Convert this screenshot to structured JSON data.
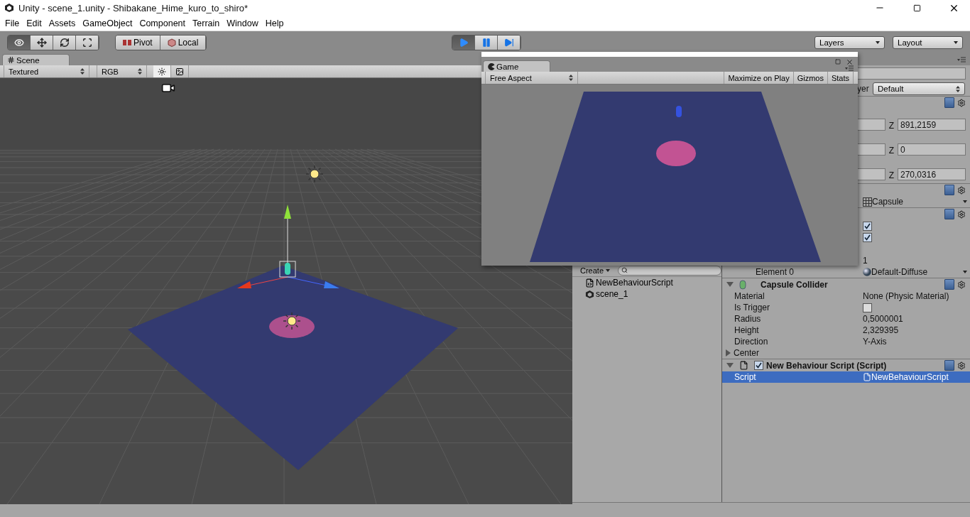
{
  "window": {
    "title": "Unity - scene_1.unity - Shibakane_Hime_kuro_to_shiro*"
  },
  "menu": [
    "File",
    "Edit",
    "Assets",
    "GameObject",
    "Component",
    "Terrain",
    "Window",
    "Help"
  ],
  "toolbar": {
    "tools": [
      {
        "kind": "view",
        "selected": true
      },
      {
        "kind": "move",
        "selected": false
      },
      {
        "kind": "rotate",
        "selected": false
      },
      {
        "kind": "scale",
        "selected": false
      }
    ],
    "handles": [
      {
        "kind": "pivot",
        "label": "Pivot"
      },
      {
        "kind": "local",
        "label": "Local"
      }
    ],
    "playback": [
      {
        "kind": "play",
        "selected": true
      },
      {
        "kind": "pause",
        "selected": false
      },
      {
        "kind": "step",
        "selected": false
      }
    ],
    "layers": "Layers",
    "layout": "Layout"
  },
  "scene": {
    "tab": {
      "label": "Scene",
      "selected": true
    },
    "render_mode": "Textured",
    "channel": "RGB",
    "toggles": [
      {
        "kind": "lighting",
        "on": true
      },
      {
        "kind": "skybox",
        "on": false
      }
    ]
  },
  "game": {
    "tab": {
      "label": "Game",
      "selected": true
    },
    "aspect": "Free Aspect",
    "buttons": [
      {
        "label": "Maximize on Play",
        "on": false
      },
      {
        "label": "Gizmos",
        "on": false
      },
      {
        "label": "Stats",
        "on": false
      }
    ]
  },
  "project": {
    "create": "Create",
    "items": [
      {
        "kind": "script",
        "label": "NewBehaviourScript"
      },
      {
        "kind": "scene",
        "label": "scene_1"
      }
    ]
  },
  "inspector": {
    "rows": [
      {
        "kind": "name"
      },
      {
        "kind": "layer",
        "label": "yer",
        "value": "Default"
      },
      {
        "kind": "header"
      },
      {
        "kind": "vector",
        "axis": "Z",
        "value": "891,2159"
      },
      {
        "kind": "vector",
        "axis": "Z",
        "value": "0"
      },
      {
        "kind": "vector",
        "axis": "Z",
        "value": "270,0316"
      },
      {
        "kind": "header"
      },
      {
        "kind": "mesh",
        "value": "Capsule"
      },
      {
        "kind": "header"
      },
      {
        "kind": "check",
        "checked": true
      },
      {
        "kind": "check",
        "checked": true
      },
      {
        "kind": "count",
        "value": "1"
      },
      {
        "kind": "material",
        "label": "Element 0",
        "value": "Default-Diffuse",
        "selected": false
      },
      {
        "kind": "collider_header",
        "title": "Capsule Collider",
        "expanded": true
      },
      {
        "kind": "property",
        "label": "Material",
        "value": "None (Physic Material)",
        "selected": false
      },
      {
        "kind": "toggle",
        "label": "Is Trigger",
        "checked": false,
        "selected": false
      },
      {
        "kind": "property",
        "label": "Radius",
        "value": "0,5000001",
        "selected": false
      },
      {
        "kind": "property",
        "label": "Height",
        "value": "2,329395",
        "selected": false
      },
      {
        "kind": "property",
        "label": "Direction",
        "value": "Y-Axis",
        "selected": false
      },
      {
        "kind": "foldout",
        "label": "Center",
        "expanded": false,
        "selected": false
      },
      {
        "kind": "script_header",
        "title": "New Behaviour Script (Script)",
        "expanded": true,
        "enabled": true
      },
      {
        "kind": "script",
        "label": "Script",
        "value": "NewBehaviourScript",
        "selected": true
      }
    ]
  }
}
